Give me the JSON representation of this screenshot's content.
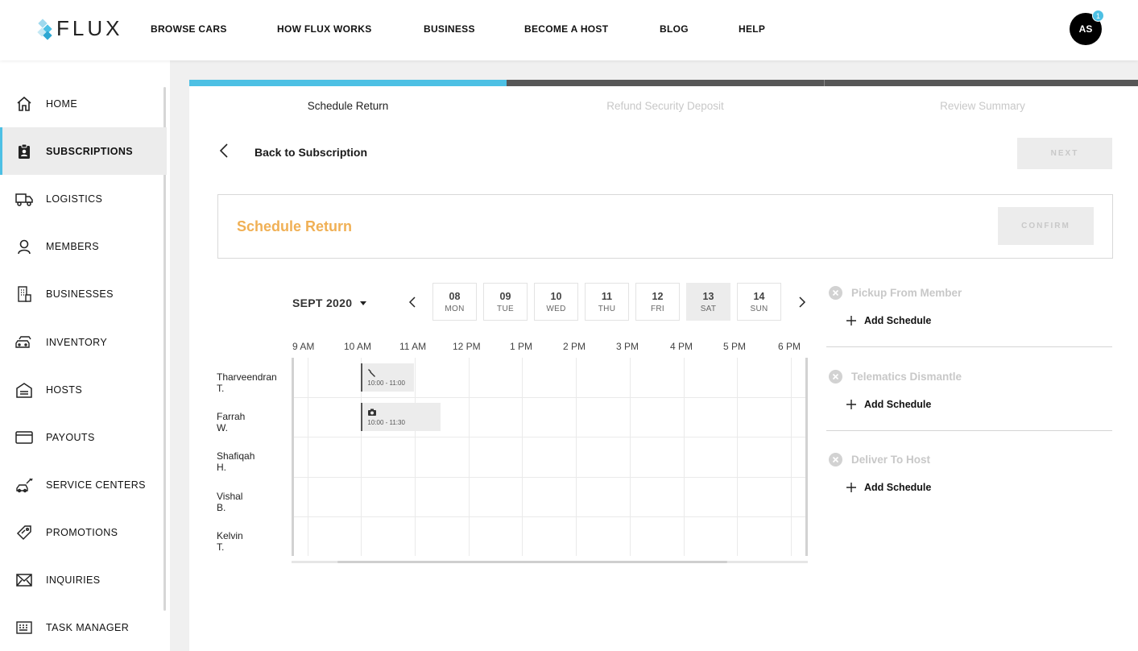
{
  "brand": {
    "name": "FLUX",
    "accent": "#4dc0e4",
    "orange": "#f0b055"
  },
  "nav": [
    "BROWSE CARS",
    "HOW FLUX WORKS",
    "BUSINESS",
    "BECOME A HOST",
    "BLOG",
    "HELP"
  ],
  "user": {
    "initials": "AS",
    "notifications": "1"
  },
  "sidebar": [
    {
      "label": "HOME",
      "icon": "home-icon"
    },
    {
      "label": "SUBSCRIPTIONS",
      "icon": "clipboard-user-icon",
      "active": true
    },
    {
      "label": "LOGISTICS",
      "icon": "truck-icon"
    },
    {
      "label": "MEMBERS",
      "icon": "person-icon"
    },
    {
      "label": "BUSINESSES",
      "icon": "building-icon"
    },
    {
      "label": "INVENTORY",
      "icon": "cars-icon"
    },
    {
      "label": "HOSTS",
      "icon": "garage-icon"
    },
    {
      "label": "PAYOUTS",
      "icon": "card-icon"
    },
    {
      "label": "SERVICE CENTERS",
      "icon": "mechanic-icon"
    },
    {
      "label": "PROMOTIONS",
      "icon": "tag-icon"
    },
    {
      "label": "INQUIRIES",
      "icon": "envelope-icon"
    },
    {
      "label": "TASK MANAGER",
      "icon": "keyboard-icon"
    }
  ],
  "steps": [
    {
      "label": "Schedule Return",
      "active": true
    },
    {
      "label": "Refund Security Deposit",
      "active": false
    },
    {
      "label": "Review Summary",
      "active": false
    }
  ],
  "back_label": "Back to Subscription",
  "next_label": "NEXT",
  "section_title": "Schedule Return",
  "confirm_label": "CONFIRM",
  "calendar": {
    "month": "SEPT 2020",
    "days": [
      {
        "num": "08",
        "name": "MON"
      },
      {
        "num": "09",
        "name": "TUE"
      },
      {
        "num": "10",
        "name": "WED"
      },
      {
        "num": "11",
        "name": "THU"
      },
      {
        "num": "12",
        "name": "FRI"
      },
      {
        "num": "13",
        "name": "SAT",
        "selected": true
      },
      {
        "num": "14",
        "name": "SUN"
      }
    ],
    "times": [
      "9 AM",
      "10 AM",
      "11 AM",
      "12 PM",
      "1 PM",
      "2 PM",
      "3 PM",
      "4 PM",
      "5 PM",
      "6 PM"
    ],
    "people": [
      {
        "first": "Tharveendran",
        "last": "T."
      },
      {
        "first": "Farrah",
        "last": "W."
      },
      {
        "first": "Shafiqah",
        "last": "H."
      },
      {
        "first": "Vishal",
        "last": "B."
      },
      {
        "first": "Kelvin",
        "last": "T."
      }
    ],
    "events": [
      {
        "row": 0,
        "start": 10.0,
        "end": 11.0,
        "time": "10:00 - 11:00",
        "icon": "wrench-icon"
      },
      {
        "row": 1,
        "start": 10.0,
        "end": 11.5,
        "time": "10:00 - 11:30",
        "icon": "camera-icon"
      }
    ]
  },
  "tasks": [
    {
      "title": "Pickup From Member",
      "add_label": "Add Schedule"
    },
    {
      "title": "Telematics Dismantle",
      "add_label": "Add Schedule"
    },
    {
      "title": "Deliver To Host",
      "add_label": "Add Schedule"
    }
  ]
}
